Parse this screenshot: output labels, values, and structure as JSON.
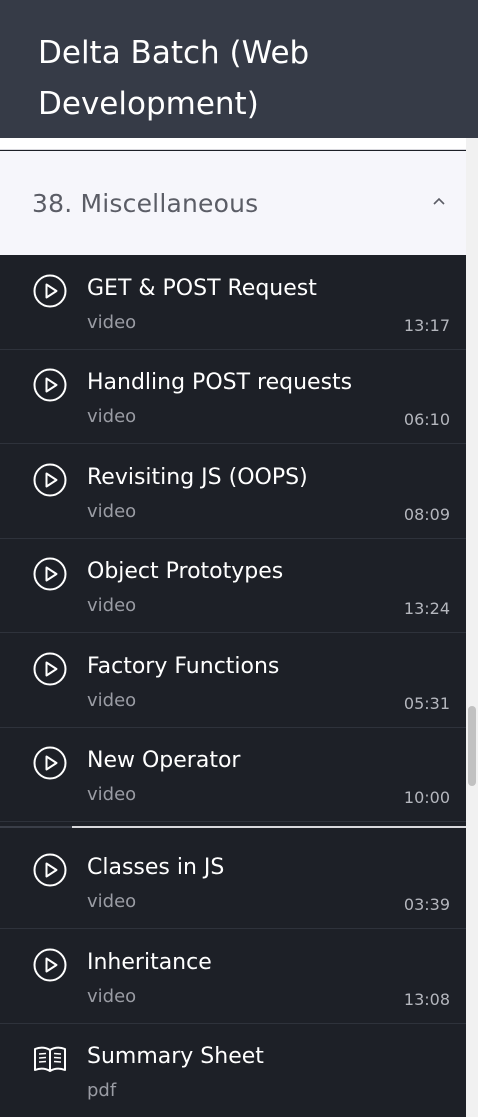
{
  "course": {
    "title": "Delta Batch (Web Development)"
  },
  "section": {
    "title": "38. Miscellaneous",
    "expanded": true
  },
  "lessons": [
    {
      "title": "GET & POST Request",
      "type": "video",
      "duration": "13:17",
      "icon": "play-circle-icon"
    },
    {
      "title": "Handling POST requests",
      "type": "video",
      "duration": "06:10",
      "icon": "play-circle-icon"
    },
    {
      "title": "Revisiting JS (OOPS)",
      "type": "video",
      "duration": "08:09",
      "icon": "play-circle-icon"
    },
    {
      "title": "Object Prototypes",
      "type": "video",
      "duration": "13:24",
      "icon": "play-circle-icon"
    },
    {
      "title": "Factory Functions",
      "type": "video",
      "duration": "05:31",
      "icon": "play-circle-icon"
    },
    {
      "title": "New Operator",
      "type": "video",
      "duration": "10:00",
      "icon": "play-circle-icon"
    },
    {
      "title": "Classes in JS",
      "type": "video",
      "duration": "03:39",
      "icon": "play-circle-icon"
    },
    {
      "title": "Inheritance",
      "type": "video",
      "duration": "13:08",
      "icon": "play-circle-icon"
    },
    {
      "title": "Summary Sheet",
      "type": "pdf",
      "duration": "",
      "icon": "book-icon"
    }
  ],
  "colors": {
    "header_bg": "#363b47",
    "list_bg": "#1d2027",
    "section_bg": "#f6f6fb"
  }
}
